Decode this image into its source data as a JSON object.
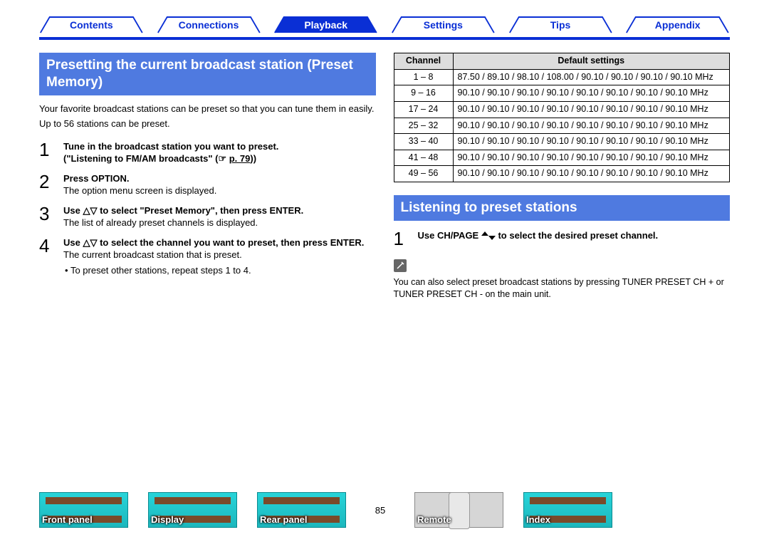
{
  "nav": {
    "items": [
      {
        "label": "Contents",
        "active": false
      },
      {
        "label": "Connections",
        "active": false
      },
      {
        "label": "Playback",
        "active": true
      },
      {
        "label": "Settings",
        "active": false
      },
      {
        "label": "Tips",
        "active": false
      },
      {
        "label": "Appendix",
        "active": false
      }
    ]
  },
  "left": {
    "heading": "Presetting the current broadcast station (Preset Memory)",
    "intro1": "Your favorite broadcast stations can be preset so that you can tune them in easily.",
    "intro2": "Up to 56 stations can be preset.",
    "steps": [
      {
        "num": "1",
        "bold1": "Tune in the broadcast station you want to preset.",
        "bold2_prefix": "(\"Listening to FM/AM broadcasts\" (",
        "link": "p. 79",
        "bold2_suffix": "))"
      },
      {
        "num": "2",
        "bold1": "Press OPTION.",
        "sub": "The option menu screen is displayed."
      },
      {
        "num": "3",
        "bold1": "Use △▽ to select \"Preset Memory\", then press ENTER.",
        "sub": "The list of already preset channels is displayed."
      },
      {
        "num": "4",
        "bold1": "Use △▽ to select the channel you want to preset, then press ENTER.",
        "sub": "The current broadcast station that is preset.",
        "bullet": "To preset other stations, repeat steps 1 to 4."
      }
    ]
  },
  "right": {
    "table_headers": {
      "ch": "Channel",
      "def": "Default settings"
    },
    "rows": [
      {
        "ch": "1 – 8",
        "def": "87.50 / 89.10 / 98.10 / 108.00 / 90.10 / 90.10 / 90.10 / 90.10 MHz"
      },
      {
        "ch": "9 – 16",
        "def": "90.10 / 90.10 / 90.10 / 90.10 / 90.10 / 90.10 / 90.10 / 90.10 MHz"
      },
      {
        "ch": "17 – 24",
        "def": "90.10 / 90.10 / 90.10 / 90.10 / 90.10 / 90.10 / 90.10 / 90.10 MHz"
      },
      {
        "ch": "25 – 32",
        "def": "90.10 / 90.10 / 90.10 / 90.10 / 90.10 / 90.10 / 90.10 / 90.10 MHz"
      },
      {
        "ch": "33 – 40",
        "def": "90.10 / 90.10 / 90.10 / 90.10 / 90.10 / 90.10 / 90.10 / 90.10 MHz"
      },
      {
        "ch": "41 – 48",
        "def": "90.10 / 90.10 / 90.10 / 90.10 / 90.10 / 90.10 / 90.10 / 90.10 MHz"
      },
      {
        "ch": "49 – 56",
        "def": "90.10 / 90.10 / 90.10 / 90.10 / 90.10 / 90.10 / 90.10 / 90.10 MHz"
      }
    ],
    "heading2": "Listening to preset stations",
    "step1_prefix": "Use CH/PAGE ",
    "step1_suffix": " to select the desired preset channel.",
    "note": "You can also select preset broadcast stations by pressing TUNER PRESET CH + or TUNER PRESET CH - on the main unit."
  },
  "footer": {
    "items": [
      {
        "label": "Front panel"
      },
      {
        "label": "Display"
      },
      {
        "label": "Rear panel"
      }
    ],
    "page": "85",
    "items2": [
      {
        "label": "Remote"
      },
      {
        "label": "Index"
      }
    ]
  },
  "chart_data": {
    "type": "table",
    "title": "Default preset channel settings",
    "columns": [
      "Channel",
      "Default settings"
    ],
    "rows": [
      [
        "1 – 8",
        "87.50 / 89.10 / 98.10 / 108.00 / 90.10 / 90.10 / 90.10 / 90.10 MHz"
      ],
      [
        "9 – 16",
        "90.10 / 90.10 / 90.10 / 90.10 / 90.10 / 90.10 / 90.10 / 90.10 MHz"
      ],
      [
        "17 – 24",
        "90.10 / 90.10 / 90.10 / 90.10 / 90.10 / 90.10 / 90.10 / 90.10 MHz"
      ],
      [
        "25 – 32",
        "90.10 / 90.10 / 90.10 / 90.10 / 90.10 / 90.10 / 90.10 / 90.10 MHz"
      ],
      [
        "33 – 40",
        "90.10 / 90.10 / 90.10 / 90.10 / 90.10 / 90.10 / 90.10 / 90.10 MHz"
      ],
      [
        "41 – 48",
        "90.10 / 90.10 / 90.10 / 90.10 / 90.10 / 90.10 / 90.10 / 90.10 MHz"
      ],
      [
        "49 – 56",
        "90.10 / 90.10 / 90.10 / 90.10 / 90.10 / 90.10 / 90.10 / 90.10 MHz"
      ]
    ]
  }
}
